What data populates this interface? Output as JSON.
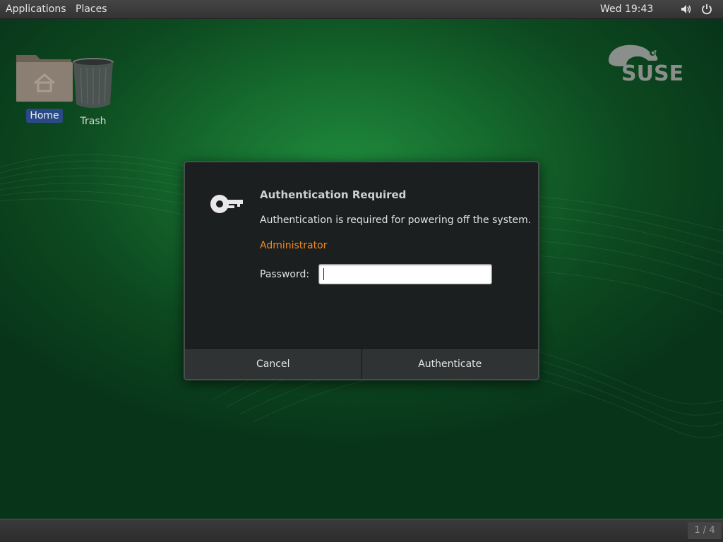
{
  "topbar": {
    "applications_label": "Applications",
    "places_label": "Places",
    "clock": "Wed 19:43",
    "tray_icons": [
      "volume-icon",
      "power-icon"
    ]
  },
  "desktop": {
    "icons": [
      {
        "label": "Home",
        "icon": "home-folder-icon",
        "selected": true
      },
      {
        "label": "Trash",
        "icon": "trash-icon",
        "selected": false
      }
    ],
    "logo": "SUSE"
  },
  "dialog": {
    "icon": "key-icon",
    "title": "Authentication Required",
    "message": "Authentication is required for powering off the system.",
    "user": "Administrator",
    "password_label": "Password:",
    "password_value": "",
    "cancel_label": "Cancel",
    "authenticate_label": "Authenticate"
  },
  "bottombar": {
    "workspace_indicator": "1 / 4"
  },
  "colors": {
    "accent_user": "#f08a24",
    "desktop_green": "#15692d",
    "dialog_bg": "#1c1f1f",
    "selection": "#2a4a86"
  }
}
